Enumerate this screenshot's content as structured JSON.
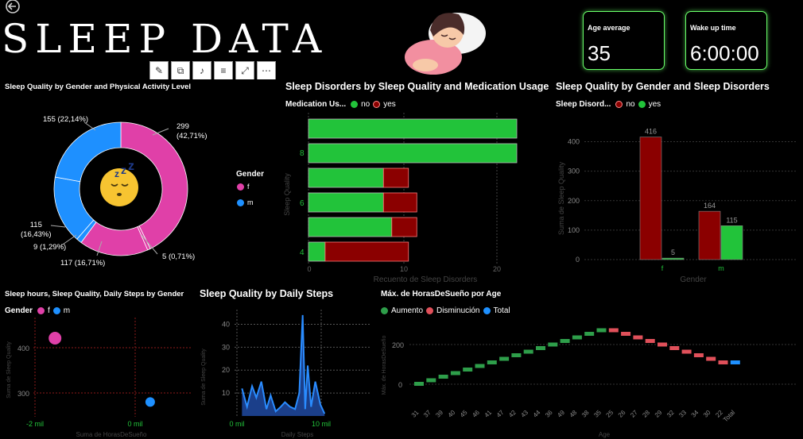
{
  "header": {
    "title": "SLEEP DATA",
    "kpis": [
      {
        "label": "Age average",
        "value": "35"
      },
      {
        "label": "Wake up time",
        "value": "6:00:00"
      }
    ],
    "colors": {
      "f": "#e040a8",
      "m": "#1e90ff",
      "no": "#22c33a",
      "yes": "#8b0000",
      "increase": "#2e9e4a",
      "decrease": "#e0505a",
      "total": "#1e90ff"
    }
  },
  "donut": {
    "title": "Sleep Quality by Gender and Physical Activity Level",
    "legend_title": "Gender",
    "legend": [
      "f",
      "m"
    ],
    "labels": [
      {
        "value": "299",
        "pct": "(42,71%)"
      },
      {
        "value": "5",
        "pct": "(0,71%)"
      },
      {
        "value": "117",
        "pct": "(16,71%)"
      },
      {
        "value": "9",
        "pct": "(1,29%)"
      },
      {
        "value": "115",
        "pct": "(16,43%)"
      },
      {
        "value": "155",
        "pct": "(22,14%)"
      }
    ]
  },
  "disorders_med": {
    "title": "Sleep Disorders by Sleep Quality and Medication Usage",
    "legend_title": "Medication Us...",
    "legend": [
      "no",
      "yes"
    ],
    "xlabel": "Recuento de Sleep Disorders",
    "ylabel": "Sleep Quality",
    "xticks": [
      "0",
      "10",
      "20"
    ],
    "yticks": [
      "8",
      "6",
      "4"
    ]
  },
  "gender_disorders": {
    "title": "Sleep Quality by Gender and Sleep Disorders",
    "legend_title": "Sleep Disord...",
    "legend": [
      "no",
      "yes"
    ],
    "xlabel": "Gender",
    "ylabel": "Suma de Sleep Quality",
    "yticks": [
      "400",
      "300",
      "200",
      "100",
      "0"
    ],
    "categories": [
      "f",
      "m"
    ]
  },
  "hours_steps": {
    "title": "Sleep hours, Sleep Quality, Daily Steps by Gender",
    "legend_title": "Gender",
    "legend": [
      "f",
      "m"
    ],
    "xlabel": "Suma de HorasDeSueño",
    "ylabel": "Suma de Sleep Quality",
    "yticks": [
      "400",
      "300"
    ],
    "xticks": [
      "-2 mil",
      "0 mil"
    ]
  },
  "daily_steps": {
    "title": "Sleep Quality by Daily Steps",
    "xlabel": "Daily Steps",
    "ylabel": "Suma de Sleep Quality",
    "yticks": [
      "40",
      "30",
      "20",
      "10"
    ],
    "xticks": [
      "0 mil",
      "10 mil"
    ]
  },
  "waterfall": {
    "title": "Máx. de HorasDeSueño por Age",
    "legend": [
      "Aumento",
      "Disminución",
      "Total"
    ],
    "xlabel": "Age",
    "ylabel": "Máx. de HorasDeSueño",
    "yticks": [
      "200",
      "0"
    ],
    "ages": [
      "31",
      "37",
      "39",
      "40",
      "45",
      "46",
      "41",
      "47",
      "42",
      "43",
      "44",
      "36",
      "49",
      "48",
      "38",
      "35",
      "25",
      "26",
      "27",
      "28",
      "29",
      "32",
      "33",
      "34",
      "30",
      "22",
      "Total"
    ]
  },
  "chart_data": [
    {
      "type": "pie",
      "title": "Sleep Quality by Gender and Physical Activity Level",
      "slices": [
        {
          "gender": "f",
          "value": 299,
          "pct": 42.71
        },
        {
          "gender": "f",
          "value": 5,
          "pct": 0.71
        },
        {
          "gender": "f",
          "value": 117,
          "pct": 16.71
        },
        {
          "gender": "m",
          "value": 9,
          "pct": 1.29
        },
        {
          "gender": "m",
          "value": 115,
          "pct": 16.43
        },
        {
          "gender": "m",
          "value": 155,
          "pct": 22.14
        }
      ]
    },
    {
      "type": "bar",
      "orientation": "horizontal",
      "stacked": true,
      "title": "Sleep Disorders by Sleep Quality and Medication Usage",
      "xlim": [
        0,
        25
      ],
      "categories": [
        "9",
        "8",
        "7",
        "6",
        "5",
        "4"
      ],
      "series": [
        {
          "name": "no",
          "values": [
            25,
            25,
            9,
            9,
            10,
            2
          ]
        },
        {
          "name": "yes",
          "values": [
            0,
            0,
            3,
            4,
            3,
            10
          ]
        }
      ]
    },
    {
      "type": "bar",
      "title": "Sleep Quality by Gender and Sleep Disorders",
      "categories": [
        "f",
        "m"
      ],
      "ylim": [
        0,
        450
      ],
      "series": [
        {
          "name": "yes",
          "values": [
            416,
            164
          ]
        },
        {
          "name": "no",
          "values": [
            5,
            115
          ]
        }
      ]
    },
    {
      "type": "scatter",
      "title": "Sleep hours, Sleep Quality, Daily Steps by Gender",
      "xlim": [
        -2500,
        500
      ],
      "ylim": [
        260,
        450
      ],
      "series": [
        {
          "name": "f",
          "points": [
            [
              -1600,
              421
            ]
          ]
        },
        {
          "name": "m",
          "points": [
            [
              300,
              280
            ]
          ]
        }
      ]
    },
    {
      "type": "area",
      "title": "Sleep Quality by Daily Steps",
      "xlim": [
        0,
        11000
      ],
      "ylim": [
        0,
        45
      ],
      "x": [
        600,
        1200,
        1800,
        2300,
        2900,
        3500,
        4000,
        4600,
        5200,
        5700,
        6300,
        6900,
        7400,
        7800,
        8100,
        8400,
        8800,
        9300,
        9900,
        10400
      ],
      "y": [
        12,
        4,
        13,
        8,
        15,
        3,
        9,
        2,
        4,
        6,
        4,
        3,
        10,
        44,
        3,
        22,
        4,
        15,
        5,
        1
      ]
    },
    {
      "type": "bar",
      "subtype": "waterfall",
      "title": "Máx. de HorasDeSueño por Age",
      "ylim": [
        0,
        280
      ],
      "categories": [
        "31",
        "37",
        "39",
        "40",
        "45",
        "46",
        "41",
        "47",
        "42",
        "43",
        "44",
        "36",
        "49",
        "48",
        "38",
        "35",
        "25",
        "26",
        "27",
        "28",
        "29",
        "32",
        "33",
        "34",
        "30",
        "22",
        "Total"
      ],
      "values": [
        12,
        18,
        18,
        18,
        18,
        18,
        18,
        18,
        18,
        18,
        18,
        18,
        18,
        18,
        18,
        18,
        -18,
        -18,
        -18,
        -18,
        -18,
        -18,
        -18,
        -18,
        -18,
        -18,
        18
      ]
    }
  ]
}
